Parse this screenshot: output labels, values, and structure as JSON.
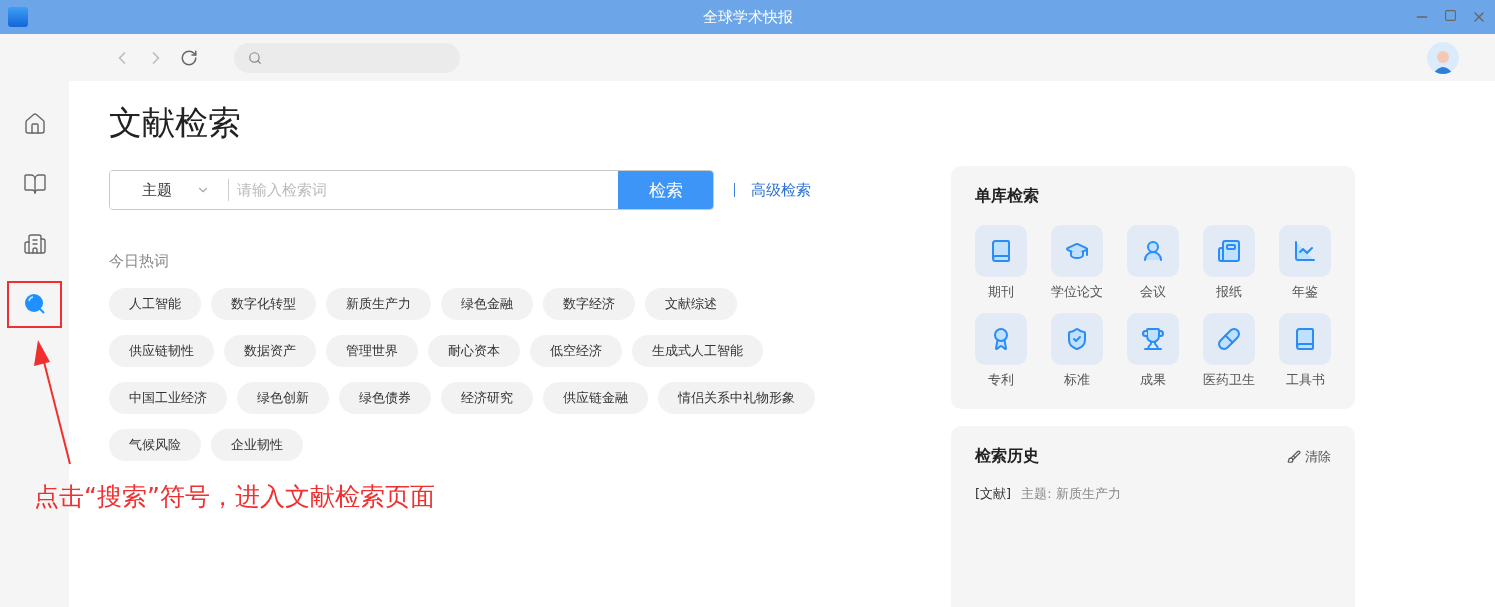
{
  "window": {
    "title": "全球学术快报"
  },
  "sidebar": {
    "items": [
      {
        "selected": false
      },
      {
        "selected": false
      },
      {
        "selected": false
      },
      {
        "selected": true
      }
    ]
  },
  "page_title": "文献检索",
  "search": {
    "field": "主题",
    "placeholder": "请输入检索词",
    "button": "检索",
    "advanced": "高级检索"
  },
  "hot_words": {
    "label": "今日热词",
    "rows": [
      [
        "人工智能",
        "数字化转型",
        "新质生产力",
        "绿色金融",
        "数字经济",
        "文献综述"
      ],
      [
        "供应链韧性",
        "数据资产",
        "管理世界",
        "耐心资本",
        "低空经济",
        "生成式人工智能"
      ],
      [
        "中国工业经济",
        "绿色创新",
        "绿色债券",
        "经济研究",
        "供应链金融",
        "情侣关系中礼物形象"
      ],
      [
        "气候风险",
        "企业韧性"
      ]
    ]
  },
  "single_db": {
    "title": "单库检索",
    "items": [
      "期刊",
      "学位论文",
      "会议",
      "报纸",
      "年鉴",
      "专利",
      "标准",
      "成果",
      "医药卫生",
      "工具书"
    ]
  },
  "history": {
    "title": "检索历史",
    "clear": "清除",
    "entries": [
      {
        "tag": "[文献]",
        "text": "主题: 新质生产力"
      }
    ]
  },
  "annotation": {
    "text": "点击“搜索”符号，进入文献检索页面"
  }
}
